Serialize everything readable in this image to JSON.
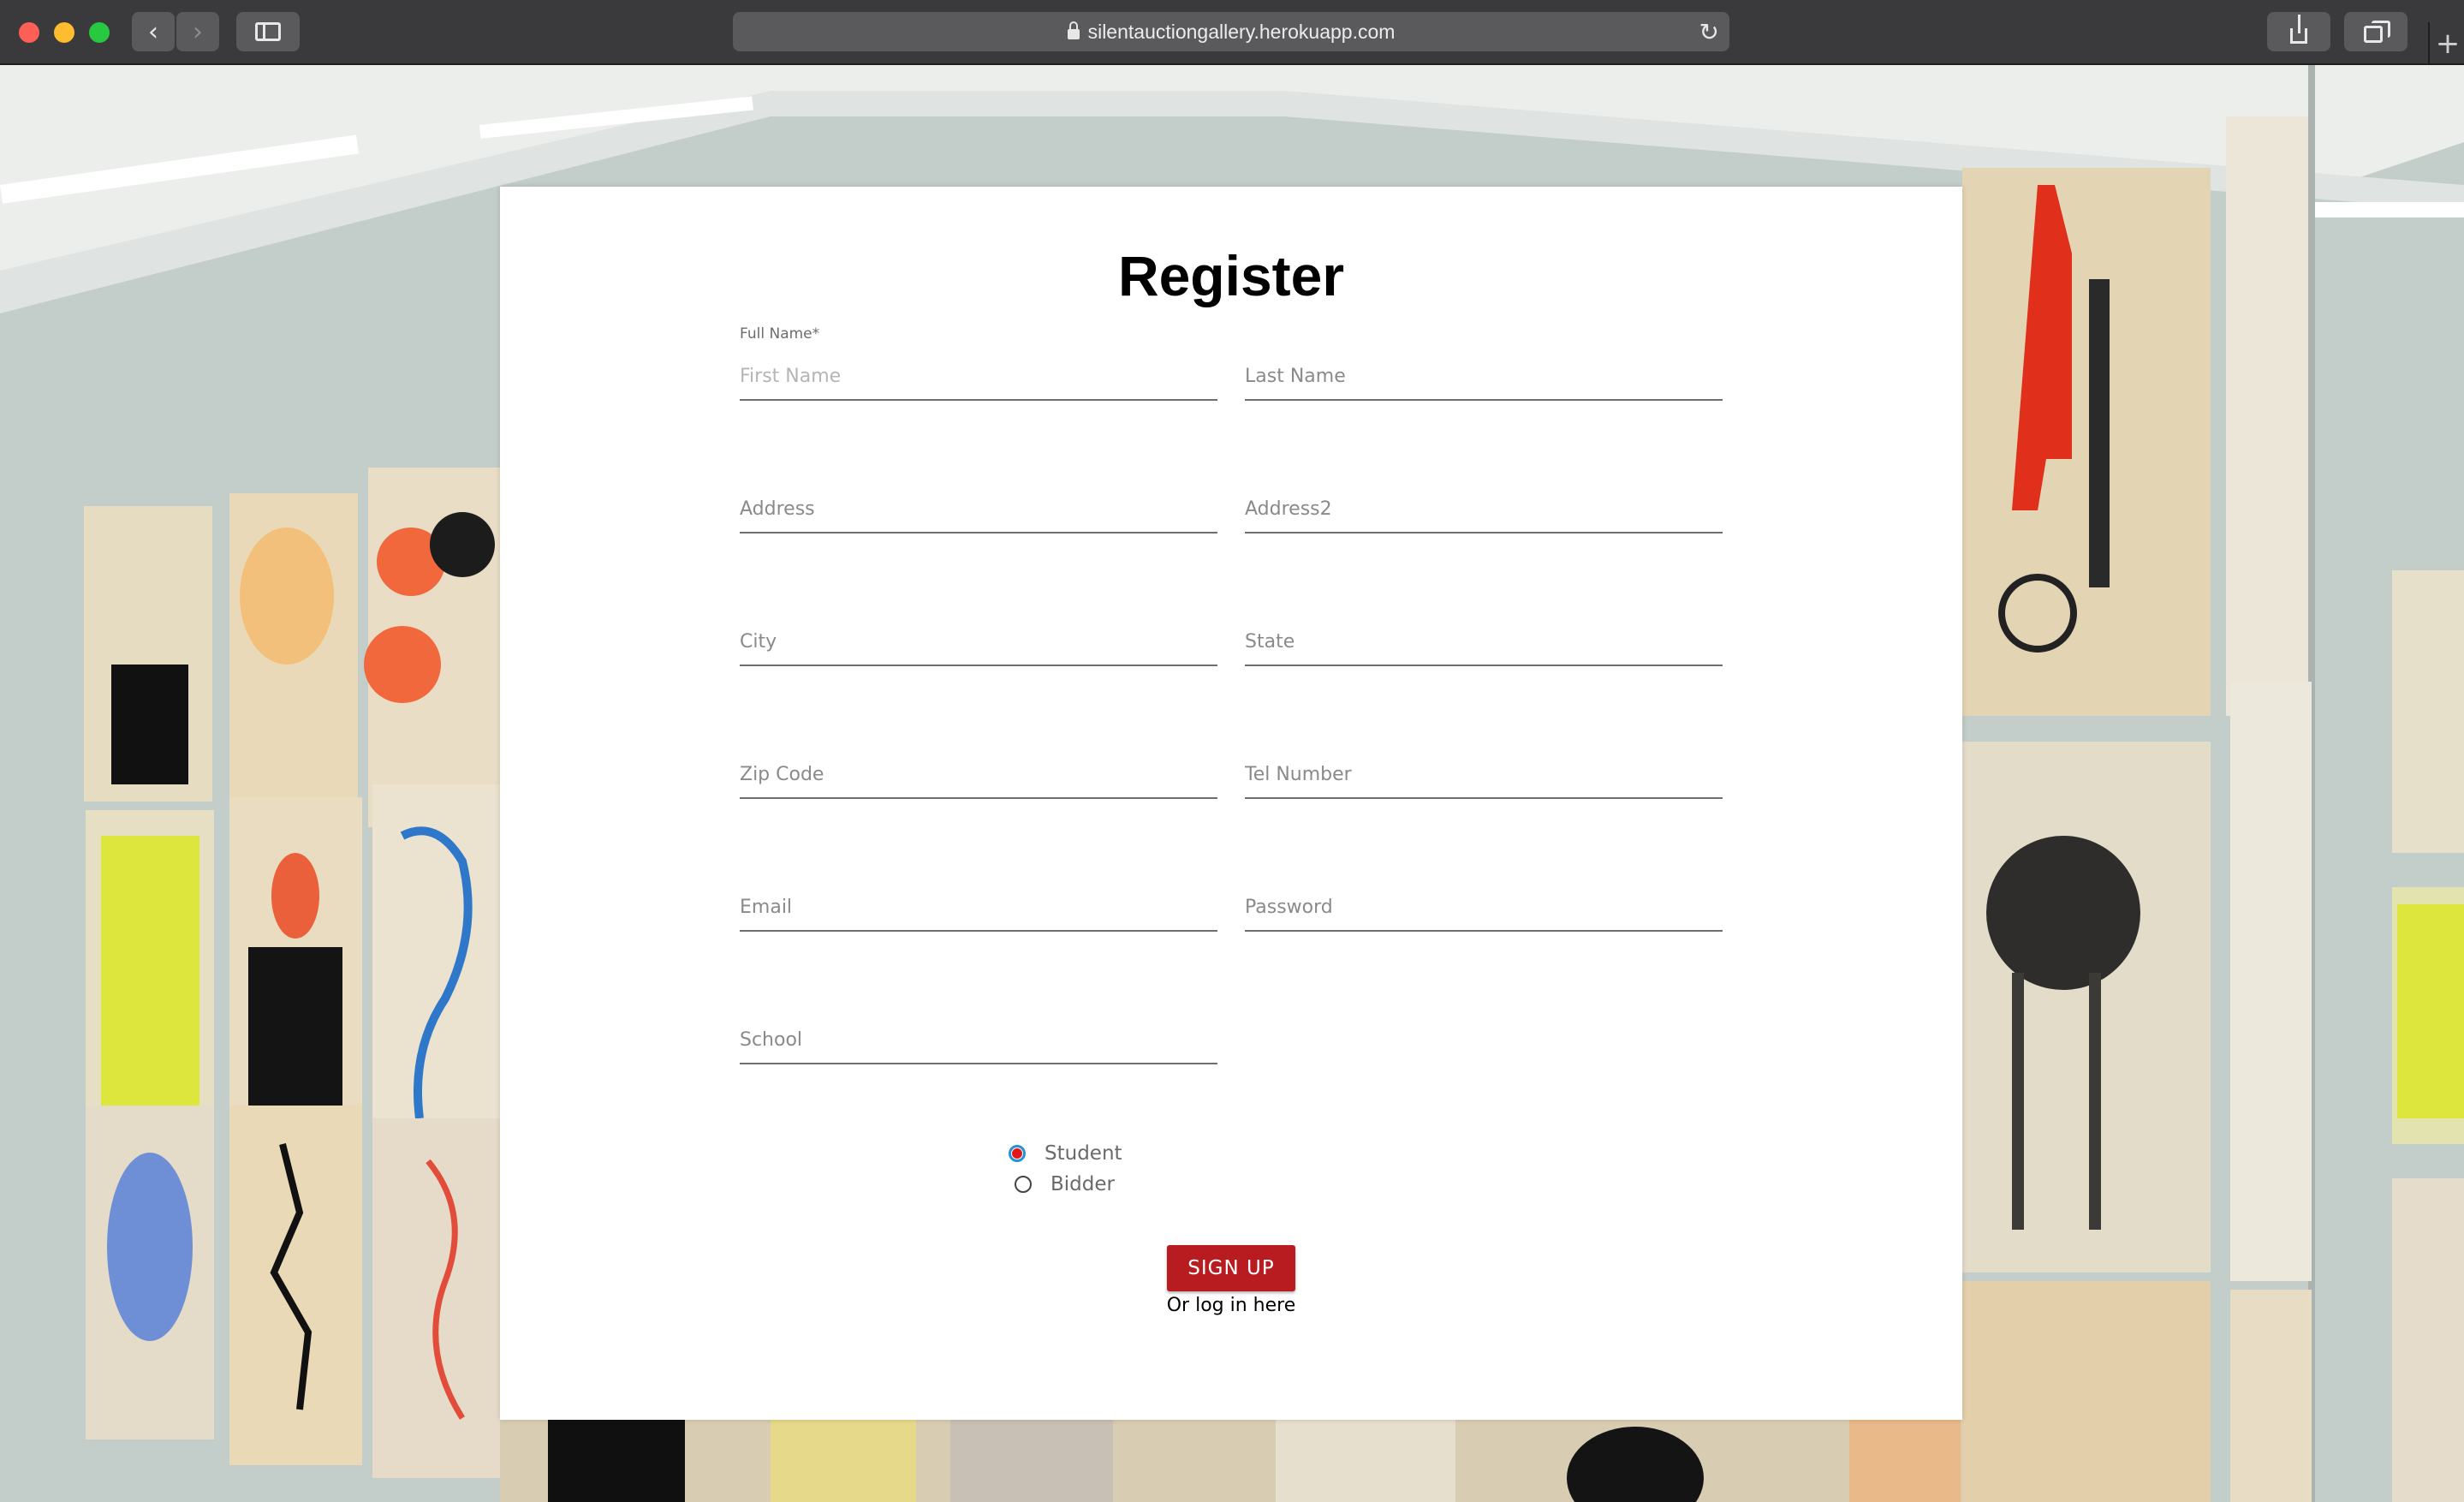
{
  "browser": {
    "url": "silentauctiongallery.herokuapp.com"
  },
  "form": {
    "title": "Register",
    "full_name_label": "Full Name*",
    "placeholders": {
      "first_name": "First Name",
      "last_name": "Last Name",
      "address": "Address",
      "address2": "Address2",
      "city": "City",
      "state": "State",
      "zip": "Zip Code",
      "tel": "Tel Number",
      "email": "Email",
      "password": "Password",
      "school": "School"
    },
    "roles": [
      {
        "label": "Student",
        "checked": true
      },
      {
        "label": "Bidder",
        "checked": false
      }
    ],
    "signup_label": "SIGN UP",
    "login_text": "Or log in here"
  },
  "colors": {
    "signup_button": "#b81c21",
    "radio_checked": "#e0181a",
    "card": "#ffffff"
  }
}
